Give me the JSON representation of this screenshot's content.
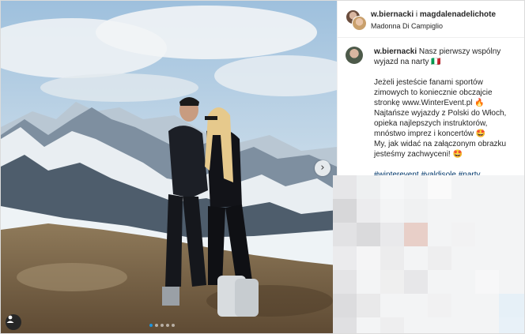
{
  "post": {
    "header": {
      "username1": "w.biernacki",
      "separator": "i",
      "username2": "magdalenadelichote",
      "location": "Madonna Di Campiglio"
    },
    "caption": {
      "username": "w.biernacki",
      "title": "Nasz pierwszy wspólny wyjazd na narty",
      "flag_emoji": "🇮🇹",
      "lines": [
        "Jeżeli jesteście fanami sportów",
        "zimowych to koniecznie obczajcie",
        "stronkę www.WinterEvent.pl 🔥",
        "Najtańsze wyjazdy z Polski do Włoch,",
        "opieka najlepszych instruktorów,",
        "mnóstwo imprez i koncertów 🤩",
        "My, jak widać na załączonym obrazku",
        "jesteśmy zachwyceni! 🤩"
      ],
      "hashtags": "#winterevent #valdisole #narty"
    },
    "carousel": {
      "next_glyph": "›",
      "dot_count": 5,
      "active_dot": 0
    }
  },
  "colors": {
    "accent": "#1b95e0",
    "link": "#00376b",
    "text": "#262626",
    "border": "#dbdbdb"
  },
  "icons": {
    "tag": "user-tag-icon",
    "next": "chevron-right-icon"
  }
}
